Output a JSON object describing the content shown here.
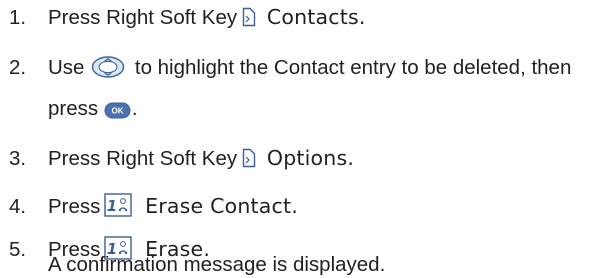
{
  "steps": [
    {
      "number": "1.",
      "before": "Press Right Soft Key",
      "icon": "right-soft-key-icon",
      "after": "Contacts."
    },
    {
      "number": "2.",
      "before": "Use",
      "icon": "navigation-key-icon",
      "after": "to highlight the Contact entry to be deleted, then",
      "line2_before": "press",
      "line2_icon": "ok-key-icon",
      "line2_after": "."
    },
    {
      "number": "3.",
      "before": "Press Right Soft Key",
      "icon": "right-soft-key-icon",
      "after": "Options."
    },
    {
      "number": "4.",
      "before": "Press",
      "icon": "key-1-icon",
      "key_label": "1",
      "after": "Erase Contact."
    },
    {
      "number": "5.",
      "before": "Press",
      "icon": "key-1-icon",
      "key_label": "1",
      "after": "Erase.",
      "line2_text": "A confirmation message is displayed."
    }
  ],
  "ok_key_label": "OK",
  "colors": {
    "text": "#231f20",
    "icon_fill": "#4a72b0",
    "icon_light": "#dbe6f5",
    "icon_stroke": "#3a5f9a"
  }
}
